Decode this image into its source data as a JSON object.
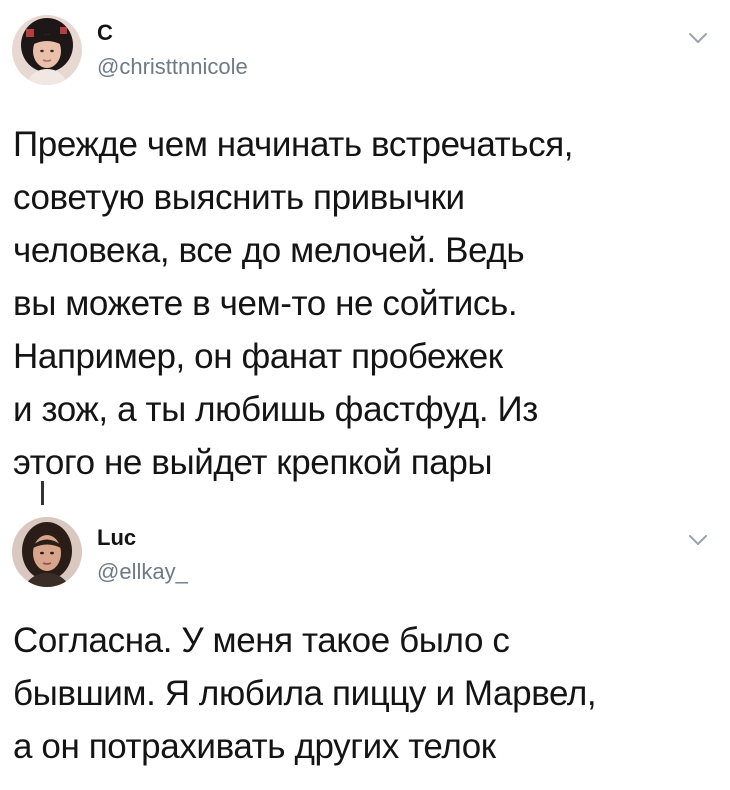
{
  "tweets": [
    {
      "display_name": "C",
      "handle": "@christtnnicole",
      "text": "Прежде чем начинать встречаться,\nсоветую выяснить привычки\nчеловека, все до мелочей. Ведь\nвы можете в чем-то не сойтись.\nНапример, он фанат пробежек\nи зож, а ты любишь фастфуд. Из\nэтого не выйдет крепкой пары",
      "avatar_icon": "user-avatar-icon",
      "menu_icon": "chevron-down-icon"
    },
    {
      "display_name": "Luc",
      "handle": "@ellkay_",
      "text": "Согласна. У меня такое было с\nбывшим. Я любила пиццу и Марвел,\nа он потрахивать других телок",
      "avatar_icon": "user-avatar-icon",
      "menu_icon": "chevron-down-icon"
    }
  ],
  "colors": {
    "text": "#141414",
    "secondary": "#6e7b86",
    "chevron": "#9aa4ad",
    "background": "#ffffff"
  }
}
